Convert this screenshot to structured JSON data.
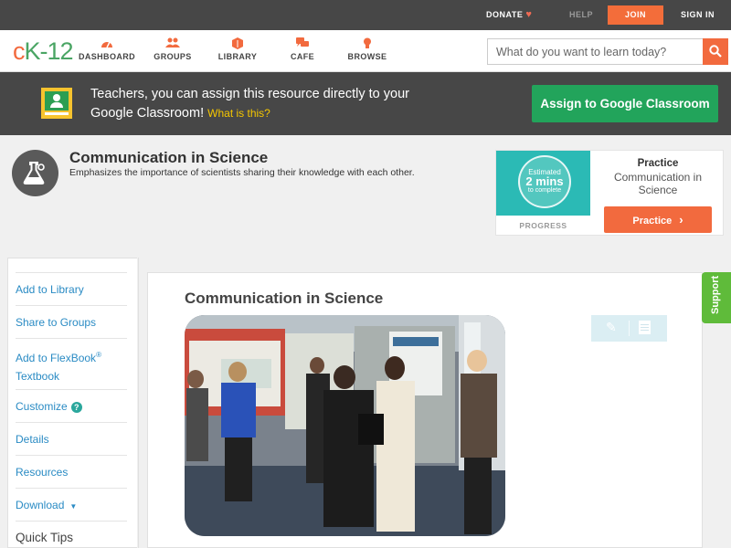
{
  "topbar": {
    "donate": "DONATE",
    "help": "HELP",
    "join": "JOIN",
    "signin": "SIGN IN"
  },
  "logo": {
    "c": "c",
    "k": "K",
    "n": "-12"
  },
  "nav": {
    "items": [
      {
        "label": "DASHBOARD",
        "icon": "dashboard-icon"
      },
      {
        "label": "GROUPS",
        "icon": "groups-icon"
      },
      {
        "label": "LIBRARY",
        "icon": "library-icon"
      },
      {
        "label": "CAFE",
        "icon": "cafe-icon"
      },
      {
        "label": "BROWSE",
        "icon": "browse-icon"
      }
    ],
    "search_placeholder": "What do you want to learn today?"
  },
  "banner": {
    "message": "Teachers, you can assign this resource directly to your Google Classroom!",
    "what_link": "What is this?",
    "assign_button": "Assign to Google Classroom"
  },
  "header": {
    "title": "Communication in Science",
    "description": "Emphasizes the importance of scientists sharing their knowledge with each other."
  },
  "practice": {
    "estimated": "Estimated",
    "mins": "2 mins",
    "to_complete": "to complete",
    "progress_label": "PROGRESS",
    "title": "Practice",
    "name": "Communication in Science",
    "button": "Practice"
  },
  "sidebar": {
    "add_library": "Add to Library",
    "share_groups": "Share to Groups",
    "add_flexbook": "Add to FlexBook",
    "add_flexbook_sup": "®",
    "add_flexbook_2": "Textbook",
    "customize": "Customize",
    "customize_help": "?",
    "details": "Details",
    "resources": "Resources",
    "download": "Download",
    "quick_tips": "Quick Tips"
  },
  "content": {
    "title": "Communication in Science"
  },
  "support": "Support",
  "colors": {
    "accent_orange": "#f26a3e",
    "brand_green": "#4aa564",
    "classroom_green": "#22a45b",
    "link_blue": "#2a8bc4",
    "support_green": "#5fbb3a"
  }
}
